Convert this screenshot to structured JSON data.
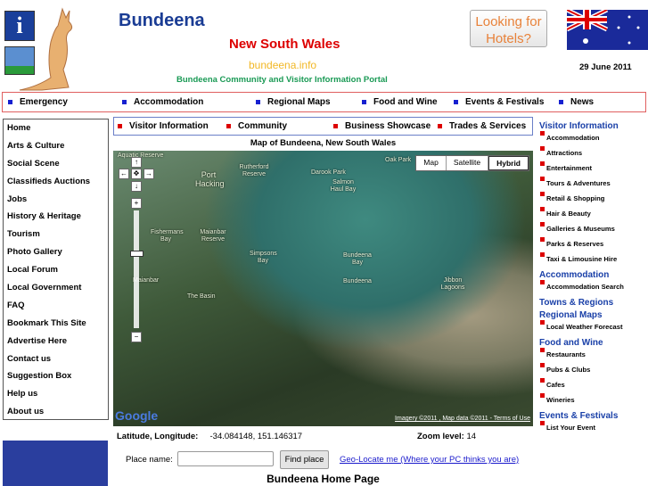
{
  "header": {
    "title": "Bundeena",
    "state": "New South Wales",
    "domain": "bundeena.info",
    "tagline": "Bundeena Community and Visitor Information Portal",
    "hotels_button": "Looking for Hotels?",
    "date": "29 June 2011",
    "info_icon_letter": "i"
  },
  "top_nav": [
    "Emergency",
    "Accommodation",
    "Regional Maps",
    "Food and Wine",
    "Events & Festivals",
    "News"
  ],
  "left_nav": [
    "Home",
    "Arts & Culture",
    "Social Scene",
    "Classifieds Auctions",
    "Jobs",
    "History & Heritage",
    "Tourism",
    "Photo Gallery",
    "Local Forum",
    "Local Government",
    "FAQ",
    "Bookmark This Site",
    "Advertise Here",
    "Contact us",
    "Suggestion Box",
    "Help us",
    "About us"
  ],
  "sub_nav": [
    "Visitor Information",
    "Community",
    "Business Showcase",
    "Trades & Services"
  ],
  "map": {
    "title": "Map of Bundeena, New South Wales",
    "types": [
      "Map",
      "Satellite",
      "Hybrid"
    ],
    "selected_type": "Hybrid",
    "labels": [
      "Aquatic Reserve",
      "Port Hacking",
      "Rutherford Reserve",
      "Darook Park",
      "Oak Park",
      "Salmon Haul Bay",
      "Fishermans Bay",
      "Maianbar Reserve",
      "Simpsons Bay",
      "Bundeena Bay",
      "Maianbar",
      "The Basin",
      "Bundeena",
      "Jibbon Lagoons"
    ],
    "attribution": "Imagery ©2011 , Map data ©2011 - Terms of Use",
    "logo": "Google"
  },
  "coords": {
    "label": "Latitude, Longitude:",
    "value": "-34.084148, 151.146317",
    "zoom_label": "Zoom level:",
    "zoom_value": "14"
  },
  "search": {
    "label": "Place name:",
    "value": "",
    "button": "Find place",
    "geo_link": "Geo-Locate me (Where your PC thinks you are)"
  },
  "home_heading": "Bundeena Home Page",
  "right_nav": [
    {
      "heading": "Visitor Information",
      "items": [
        "Accommodation",
        "Attractions",
        "Entertainment",
        "Tours & Adventures",
        "Retail & Shopping",
        "Hair & Beauty",
        "Galleries & Museums",
        "Parks & Reserves",
        "Taxi & Limousine Hire"
      ]
    },
    {
      "heading": "Accommodation",
      "items": [
        "Accommodation Search"
      ]
    },
    {
      "heading": "Towns & Regions",
      "items": []
    },
    {
      "heading": "Regional Maps",
      "items": [
        "Local Weather Forecast"
      ]
    },
    {
      "heading": "Food and Wine",
      "items": [
        "Restaurants",
        "Pubs & Clubs",
        "Cafes",
        "Wineries"
      ]
    },
    {
      "heading": "Events & Festivals",
      "items": [
        "List Your Event"
      ]
    }
  ],
  "colors": {
    "title": "#1a3c94",
    "state": "#dd0000",
    "domain": "#f2b826",
    "tagline": "#1a9a55",
    "hotels": "#e8823a",
    "nav_border": "#e06060",
    "right_heading": "#1a40a8"
  }
}
